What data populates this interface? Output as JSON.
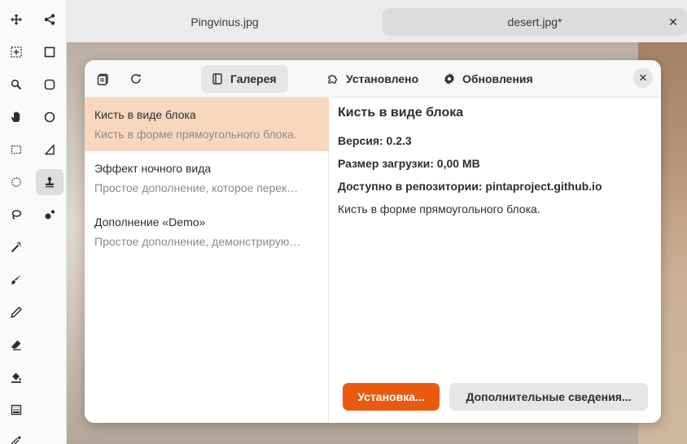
{
  "tabs": [
    {
      "label": "Pingvinus.jpg",
      "active": false
    },
    {
      "label": "desert.jpg*",
      "active": true
    }
  ],
  "tab_close": "✕",
  "tools": [
    {
      "icon": "move-icon"
    },
    {
      "icon": "share-nodes-icon"
    },
    {
      "icon": "move-selection-icon"
    },
    {
      "icon": "rectangle-icon"
    },
    {
      "icon": "zoom-icon"
    },
    {
      "icon": "rounded-rectangle-icon"
    },
    {
      "icon": "pan-hand-icon"
    },
    {
      "icon": "ellipse-icon"
    },
    {
      "icon": "rectangle-select-icon"
    },
    {
      "icon": "freeform-shape-icon"
    },
    {
      "icon": "ellipse-select-icon"
    },
    {
      "icon": "clone-stamp-icon"
    },
    {
      "icon": "lasso-icon"
    },
    {
      "icon": "recolor-icon"
    },
    {
      "icon": "magic-wand-icon"
    },
    {
      "icon": "paintbrush-icon"
    },
    {
      "icon": "pencil-icon"
    },
    {
      "icon": "eraser-icon"
    },
    {
      "icon": "paint-bucket-icon"
    },
    {
      "icon": "gradient-icon"
    },
    {
      "icon": "color-picker-icon"
    }
  ],
  "dialog": {
    "switcher": [
      {
        "label": "Галерея",
        "icon": "book-icon",
        "active": true
      },
      {
        "label": "Установлено",
        "icon": "puzzle-icon",
        "active": false
      },
      {
        "label": "Обновления",
        "icon": "gear-icon",
        "active": false
      }
    ],
    "close": "✕",
    "addins": [
      {
        "title": "Кисть в виде блока",
        "subtitle": "Кисть в форме прямоугольного блока.",
        "selected": true
      },
      {
        "title": "Эффект ночного вида",
        "subtitle": "Простое дополнение, которое перек…",
        "selected": false
      },
      {
        "title": "Дополнение «Demo»",
        "subtitle": "Простое дополнение, демонстрирую…",
        "selected": false
      }
    ],
    "details": {
      "title": "Кисть в виде блока",
      "version": "Версия: 0.2.3",
      "size": "Размер загрузки: 0,00 MB",
      "repo": "Доступно в репозитории: pintaproject.github.io",
      "description": "Кисть в форме прямоугольного блока."
    },
    "install_label": "Установка...",
    "more_info_label": "Дополнительные сведения..."
  },
  "colors": {
    "accent": "#e95a10",
    "selection": "#f9d7be"
  }
}
